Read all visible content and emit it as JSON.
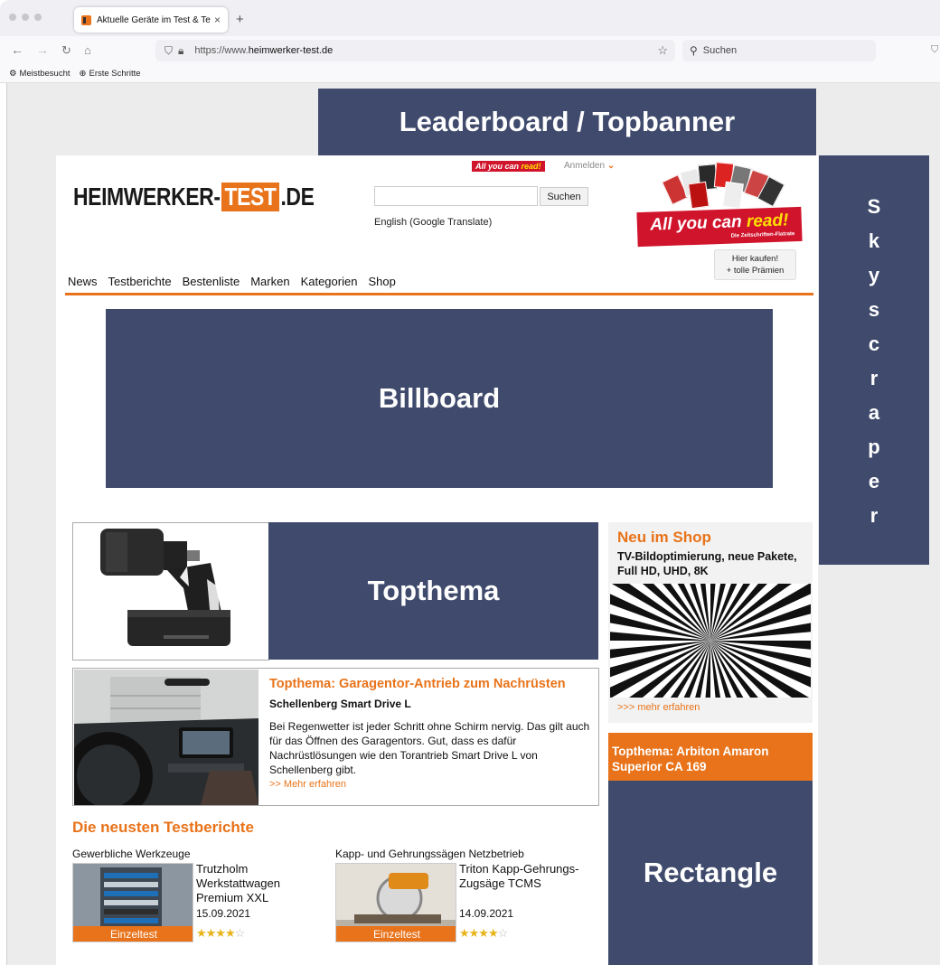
{
  "browser": {
    "tab_title": "Aktuelle Geräte im Test & Testb",
    "tab_close": "×",
    "new_tab": "+",
    "url_prefix": "https://www.",
    "url_domain": "heimwerker-test.de",
    "search_placeholder": "Suchen",
    "bookmarks": [
      "Meistbesucht",
      "Erste Schritte"
    ]
  },
  "ads": {
    "leaderboard": "Leaderboard / Topbanner",
    "skyscraper_letters": [
      "S",
      "k",
      "y",
      "s",
      "c",
      "r",
      "a",
      "p",
      "e",
      "r"
    ],
    "billboard": "Billboard",
    "topthema": "Topthema",
    "rectangle": "Rectangle"
  },
  "site": {
    "logo_left": "HEIMWERKER-",
    "logo_highlight": "TEST",
    "logo_right": ".DE",
    "ayr_badge_a": "All you can",
    "ayr_badge_b": "read!",
    "login": "Anmelden",
    "search_button": "Suchen",
    "translate": "English (Google Translate)",
    "promo_a": "All you can",
    "promo_b": "read!",
    "promo_sub": "Die Zeitschriften-Flatrate",
    "buy_line1": "Hier kaufen!",
    "buy_line2": "+ tolle Prämien",
    "nav": [
      "News",
      "Testberichte",
      "Bestenliste",
      "Marken",
      "Kategorien",
      "Shop"
    ]
  },
  "article": {
    "headline": "Topthema: Garagentor-Antrieb zum Nachrüsten",
    "subheadline": "Schellenberg Smart Drive L",
    "body": "Bei Regenwetter ist jeder Schritt ohne Schirm nervig. Das gilt auch für das Öffnen des Garagentors. Gut, dass es dafür Nachrüstlösungen wie den Torantrieb Smart Drive L von Schellenberg gibt.",
    "more": ">> Mehr erfahren"
  },
  "news": {
    "title": "Die neusten Testberichte",
    "items": [
      {
        "category": "Gewerbliche Werkzeuge",
        "name": "Trutzholm Werkstattwagen Premium XXL",
        "date": "15.09.2021",
        "badge": "Einzeltest",
        "rating": 4,
        "max": 5
      },
      {
        "category": "Kapp- und Gehrungssägen Netzbetrieb",
        "name": "Triton Kapp-Gehrungs-Zugsäge TCMS",
        "date": "14.09.2021",
        "badge": "Einzeltest",
        "rating": 4,
        "max": 5
      }
    ]
  },
  "sidebar": {
    "shop_title": "Neu im Shop",
    "shop_desc": "TV-Bildoptimierung, neue Pakete, Full HD, UHD, 8K",
    "shop_more": ">>> mehr erfahren",
    "arbiton": "Topthema: Arbiton Amaron Superior CA 169"
  },
  "colors": {
    "accent": "#e8731a",
    "ad": "#3f4a6c",
    "promo_red": "#d0142c"
  }
}
